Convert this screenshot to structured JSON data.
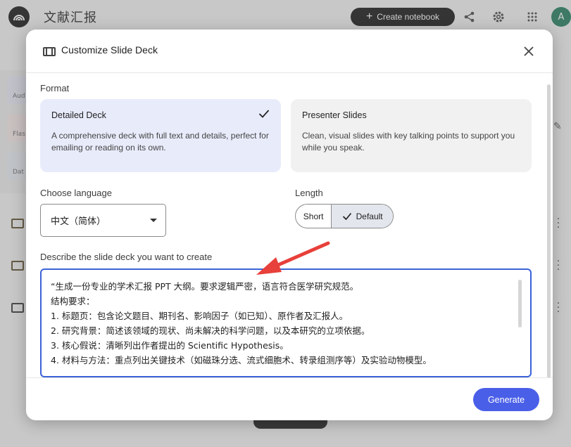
{
  "app": {
    "title": "文献汇报",
    "create_label": "Create notebook",
    "avatar_letter": "A"
  },
  "background": {
    "chips": [
      "Aud",
      "Flas",
      "Dat"
    ]
  },
  "dialog": {
    "title": "Customize Slide Deck",
    "format_label": "Format",
    "formats": [
      {
        "title": "Detailed Deck",
        "desc": "A comprehensive deck with full text and details, perfect for emailing or reading on its own.",
        "selected": true
      },
      {
        "title": "Presenter Slides",
        "desc": "Clean, visual slides with key talking points to support you while you speak.",
        "selected": false
      }
    ],
    "language_label": "Choose language",
    "language_value": "中文（简体）",
    "length_label": "Length",
    "length_options": [
      "Short",
      "Default"
    ],
    "length_selected": "Default",
    "describe_label": "Describe the slide deck you want to create",
    "prompt_lines": [
      "“生成一份专业的学术汇报 PPT 大纲。要求逻辑严密，语言符合医学研究规范。",
      "结构要求：",
      "1. 标题页：包含论文题目、期刊名、影响因子（如已知）、原作者及汇报人。",
      "2. 研究背景：简述该领域的现状、尚未解决的科学问题，以及本研究的立项依据。",
      "3. 核心假说：清晰列出作者提出的 Scientific Hypothesis。",
      "4. 材料与方法：重点列出关键技术（如磁珠分选、流式细胞术、转录组测序等）及实验动物模型。"
    ],
    "generate_label": "Generate"
  },
  "colors": {
    "accent": "#4a5fe8",
    "focus_border": "#3b62d6",
    "selected_card": "#e8ebfa",
    "annotation_arrow": "#e8403a"
  }
}
